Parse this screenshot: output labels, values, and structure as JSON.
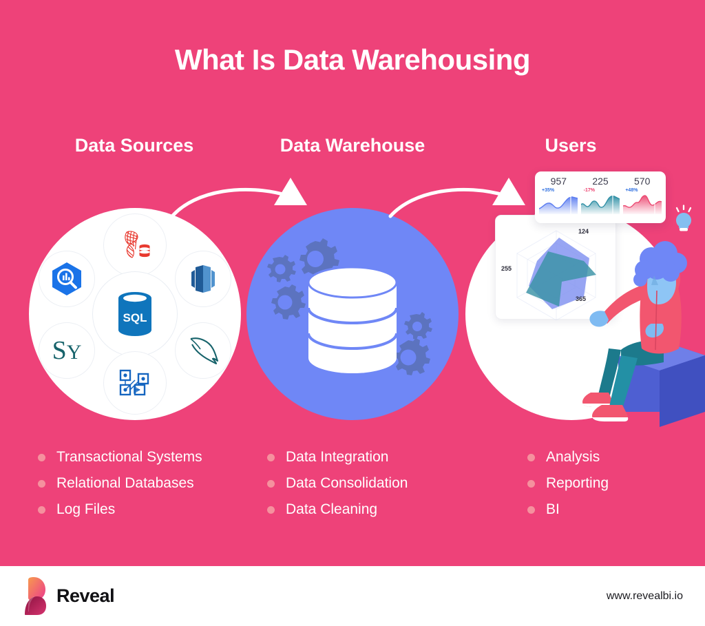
{
  "page": {
    "title": "What Is Data Warehousing",
    "background_color": "#ee4279",
    "accent_white": "#ffffff",
    "warehouse_circle_color": "#6f87f6",
    "bullet_dot_color": "#f5919e"
  },
  "columns": [
    {
      "heading": "Data Sources",
      "bullets": [
        "Transactional Systems",
        "Relational Databases",
        "Log Files"
      ]
    },
    {
      "heading": "Data Warehouse",
      "bullets": [
        "Data Integration",
        "Data Consolidation",
        "Data Cleaning"
      ]
    },
    {
      "heading": "Users",
      "bullets": [
        "Analysis",
        "Reporting",
        "BI"
      ]
    }
  ],
  "data_sources": {
    "center_logo_label": "SQL",
    "logos": [
      "sql-server-icon",
      "google-bigquery-icon",
      "amazon-redshift-icon",
      "sybase-icon",
      "mysql-icon",
      "ssis-icon"
    ]
  },
  "dashboard": {
    "kpis": [
      {
        "value": "957",
        "delta": "+35%",
        "delta_color": "#2f6fe0",
        "spark_color": "#5b7cf0"
      },
      {
        "value": "225",
        "delta": "-17%",
        "delta_color": "#ec3a6a",
        "spark_color": "#2f8fa5"
      },
      {
        "value": "570",
        "delta": "+48%",
        "delta_color": "#2f6fe0",
        "spark_color": "#ec4a72"
      }
    ],
    "radar_labels": [
      "124",
      "255",
      "365"
    ]
  },
  "footer": {
    "brand": "Reveal",
    "url": "www.revealbi.io"
  }
}
